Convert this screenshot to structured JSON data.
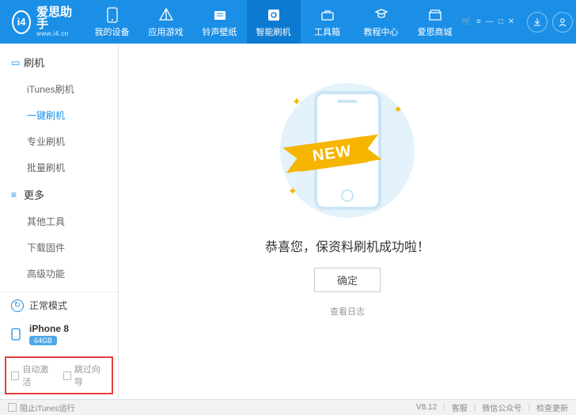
{
  "app": {
    "name_zh": "爱思助手",
    "name_en": "www.i4.cn",
    "logo_text": "i4"
  },
  "nav": [
    {
      "label": "我的设备",
      "icon": "device"
    },
    {
      "label": "应用游戏",
      "icon": "apps"
    },
    {
      "label": "铃声壁纸",
      "icon": "ringtone"
    },
    {
      "label": "智能刷机",
      "icon": "flash",
      "active": true
    },
    {
      "label": "工具箱",
      "icon": "toolbox"
    },
    {
      "label": "教程中心",
      "icon": "tutorial"
    },
    {
      "label": "爱思商城",
      "icon": "store"
    }
  ],
  "sidebar": {
    "cat1": {
      "label": "刷机"
    },
    "items1": [
      {
        "label": "iTunes刷机"
      },
      {
        "label": "一键刷机",
        "active": true
      },
      {
        "label": "专业刷机"
      },
      {
        "label": "批量刷机"
      }
    ],
    "cat2": {
      "label": "更多"
    },
    "items2": [
      {
        "label": "其他工具"
      },
      {
        "label": "下载固件"
      },
      {
        "label": "高级功能"
      }
    ],
    "mode": "正常模式",
    "device": {
      "name": "iPhone 8",
      "capacity": "64GB"
    },
    "redbox": {
      "auto_activate": "自动激活",
      "skip_wizard": "跳过向导"
    }
  },
  "main": {
    "ribbon": "NEW",
    "message": "恭喜您，保资料刷机成功啦！",
    "ok": "确定",
    "viewlog": "查看日志"
  },
  "footer": {
    "block_itunes": "阻止iTunes运行",
    "version": "V8.12",
    "support": "客服",
    "wechat": "微信公众号",
    "update": "检查更新"
  }
}
